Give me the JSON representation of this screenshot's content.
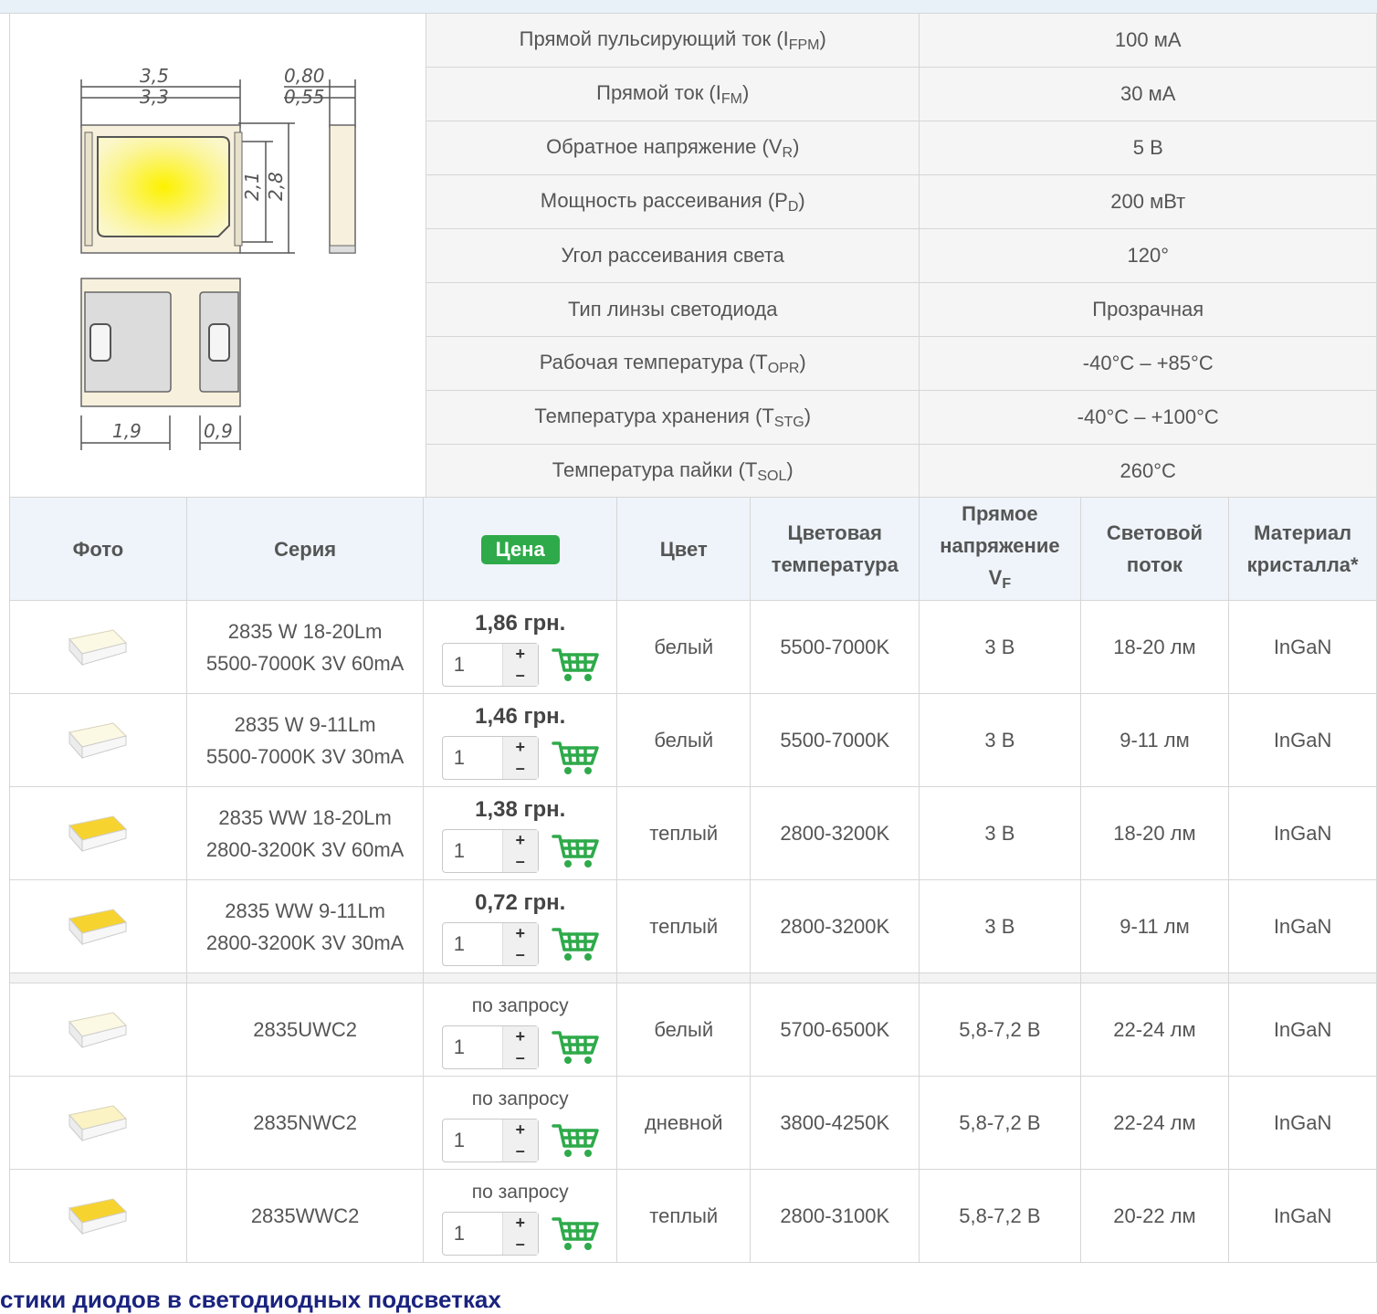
{
  "specs": [
    {
      "name": "Прямой пульсирующий ток (I",
      "sub": "FPM",
      "tail": ")",
      "value": "100 мА"
    },
    {
      "name": "Прямой ток (I",
      "sub": "FM",
      "tail": ")",
      "value": "30 мА"
    },
    {
      "name": "Обратное напряжение (V",
      "sub": "R",
      "tail": ")",
      "value": "5 В"
    },
    {
      "name": "Мощность рассеивания (P",
      "sub": "D",
      "tail": ")",
      "value": "200 мВт"
    },
    {
      "name": "Угол рассеивания света",
      "sub": "",
      "tail": "",
      "value": "120°"
    },
    {
      "name": "Тип линзы светодиода",
      "sub": "",
      "tail": "",
      "value": "Прозрачная"
    },
    {
      "name": "Рабочая температура (T",
      "sub": "OPR",
      "tail": ")",
      "value": "-40°C – +85°C"
    },
    {
      "name": "Температура хранения (T",
      "sub": "STG",
      "tail": ")",
      "value": "-40°C – +100°C"
    },
    {
      "name": "Температура пайки (T",
      "sub": "SOL",
      "tail": ")",
      "value": "260°C"
    }
  ],
  "diagram": {
    "dims": {
      "w_outer": "3,5",
      "w_inner": "3,3",
      "t_outer": "0,80",
      "t_inner": "0,55",
      "h_inner": "2,1",
      "h_outer": "2,8",
      "pad_a": "1,9",
      "pad_b": "0,9"
    }
  },
  "headers": {
    "photo": "Фото",
    "series": "Серия",
    "price": "Цена",
    "color": "Цвет",
    "cct_line1": "Цветовая",
    "cct_line2": "температура",
    "vf_line1": "Прямое",
    "vf_line2": "напряжение",
    "vf_line3": "V",
    "vf_sub": "F",
    "flux_line1": "Световой",
    "flux_line2": "поток",
    "mat_line1": "Материал",
    "mat_line2": "кристалла*"
  },
  "products": [
    {
      "series1": "2835 W 18-20Lm",
      "series2": "5500-7000K 3V 60mA",
      "price": "1,86 грн.",
      "qty": "1",
      "color": "белый",
      "cct": "5500-7000K",
      "vf": "3 В",
      "flux": "18-20 лм",
      "material": "InGaN",
      "led_color": "#fbf8e4"
    },
    {
      "series1": "2835 W 9-11Lm",
      "series2": "5500-7000K 3V 30mA",
      "price": "1,46 грн.",
      "qty": "1",
      "color": "белый",
      "cct": "5500-7000K",
      "vf": "3 В",
      "flux": "9-11 лм",
      "material": "InGaN",
      "led_color": "#fbf8e4"
    },
    {
      "series1": "2835 WW 18-20Lm",
      "series2": "2800-3200K 3V 60mA",
      "price": "1,38 грн.",
      "qty": "1",
      "color": "теплый",
      "cct": "2800-3200K",
      "vf": "3 В",
      "flux": "18-20 лм",
      "material": "InGaN",
      "led_color": "#f7d330"
    },
    {
      "series1": "2835 WW 9-11Lm",
      "series2": "2800-3200K 3V 30mA",
      "price": "0,72 грн.",
      "qty": "1",
      "color": "теплый",
      "cct": "2800-3200K",
      "vf": "3 В",
      "flux": "9-11 лм",
      "material": "InGaN",
      "led_color": "#f7d330"
    }
  ],
  "products_request": [
    {
      "series": "2835UWC2",
      "price": "по запросу",
      "qty": "1",
      "color": "белый",
      "cct": "5700-6500K",
      "vf": "5,8-7,2 В",
      "flux": "22-24 лм",
      "material": "InGaN",
      "led_color": "#fbf8e4"
    },
    {
      "series": "2835NWC2",
      "price": "по запросу",
      "qty": "1",
      "color": "дневной",
      "cct": "3800-4250K",
      "vf": "5,8-7,2 В",
      "flux": "22-24 лм",
      "material": "InGaN",
      "led_color": "#fbf3c4"
    },
    {
      "series": "2835WWC2",
      "price": "по запросу",
      "qty": "1",
      "color": "теплый",
      "cct": "2800-3100K",
      "vf": "5,8-7,2 В",
      "flux": "20-22 лм",
      "material": "InGaN",
      "led_color": "#f7d330"
    }
  ],
  "footer_heading": "стики диодов в светодиодных подсветках",
  "colors": {
    "price_badge": "#2eaa4a",
    "cart_green": "#2eaa4a",
    "header_bg": "#eef4fa",
    "heading": "#1a237e"
  }
}
